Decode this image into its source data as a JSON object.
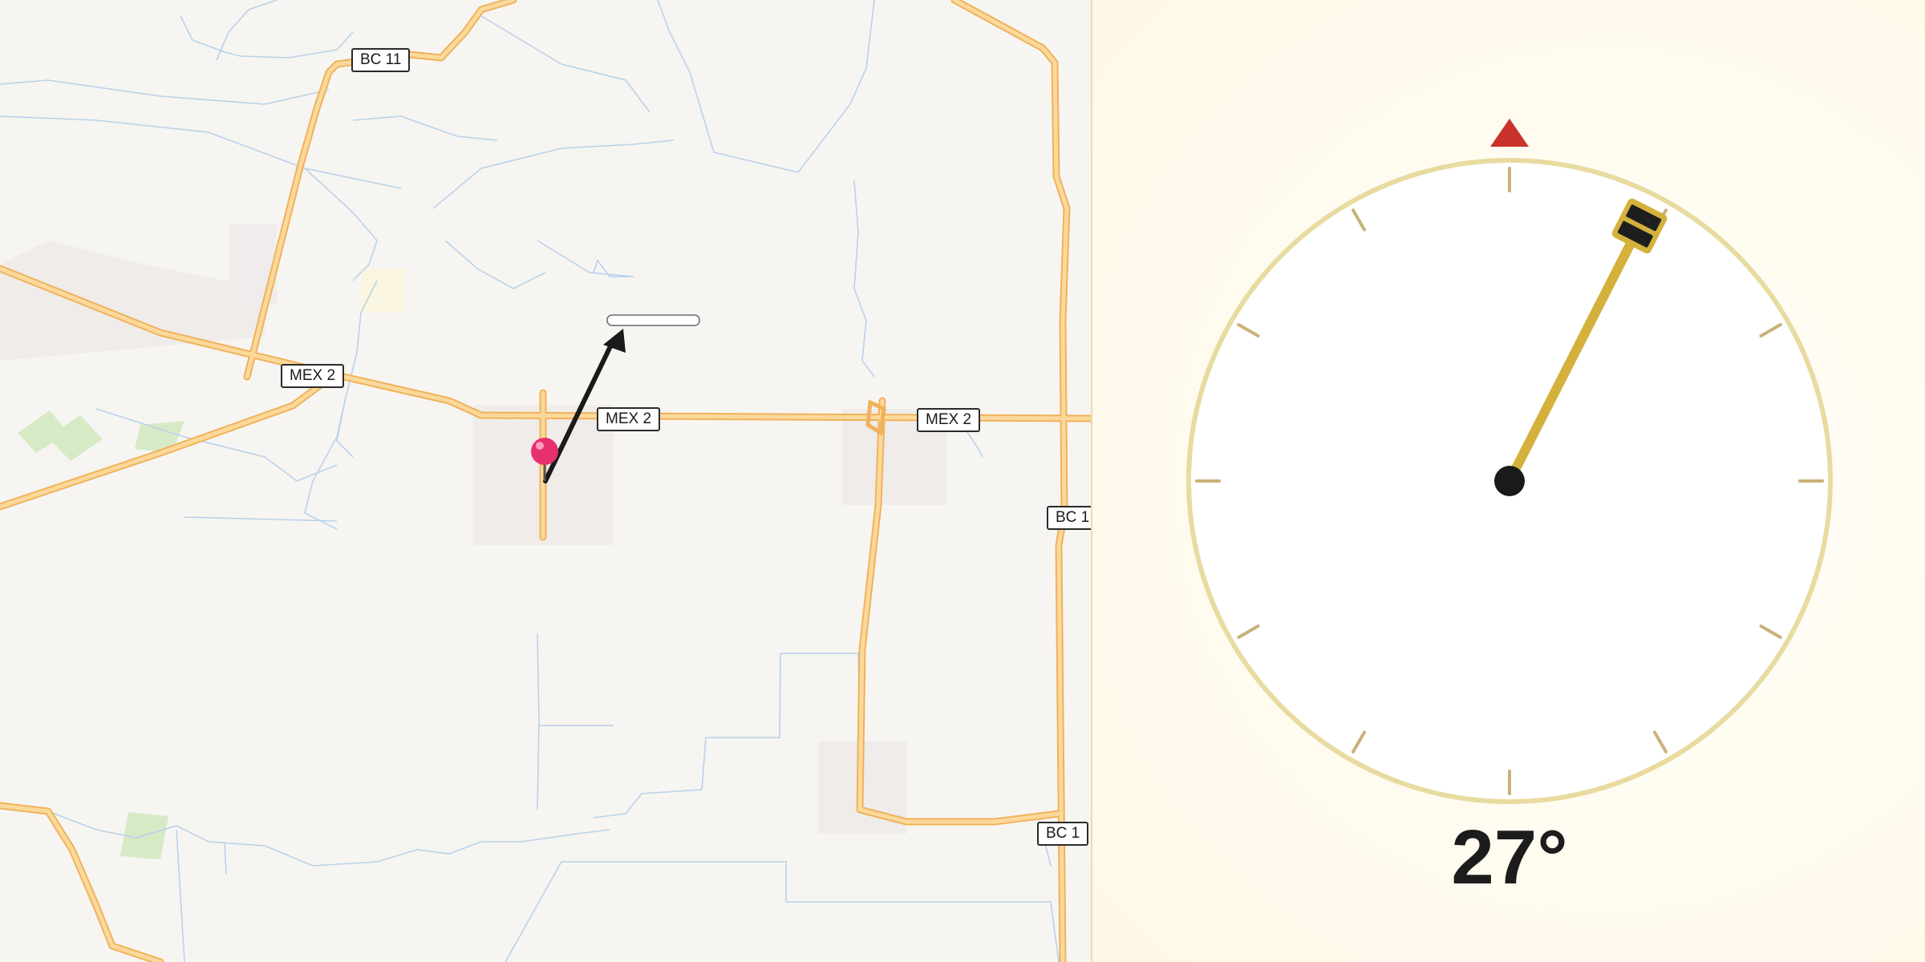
{
  "map": {
    "shields": [
      {
        "id": "bc11",
        "label": "BC 11"
      },
      {
        "id": "mex2-west",
        "label": "MEX 2"
      },
      {
        "id": "mex2-center",
        "label": "MEX 2"
      },
      {
        "id": "mex2-east",
        "label": "MEX 2"
      },
      {
        "id": "bc1-north",
        "label": "BC 1"
      },
      {
        "id": "bc1-south",
        "label": "BC 1"
      }
    ],
    "colors": {
      "background": "#f7f5f2",
      "highway": "#f7c77a",
      "highway_casing": "#f0b25a",
      "water_lines": "#a8c8e8",
      "park": "#cfe6bf",
      "pin": "#e8306f",
      "arrow": "#1a1a1a"
    },
    "pin_icon": "map-pin-icon",
    "arrow_icon": "direction-arrow-icon"
  },
  "compass": {
    "heading_deg": 27,
    "heading_label": "27°",
    "north_marker_icon": "north-triangle-icon",
    "needle_handle_icon": "needle-handle-icon",
    "colors": {
      "ring": "#e8dba0",
      "ticks": "#c9b27a",
      "needle": "#d4b13c",
      "north_marker": "#c9332b",
      "center": "#1a1a1a"
    }
  }
}
